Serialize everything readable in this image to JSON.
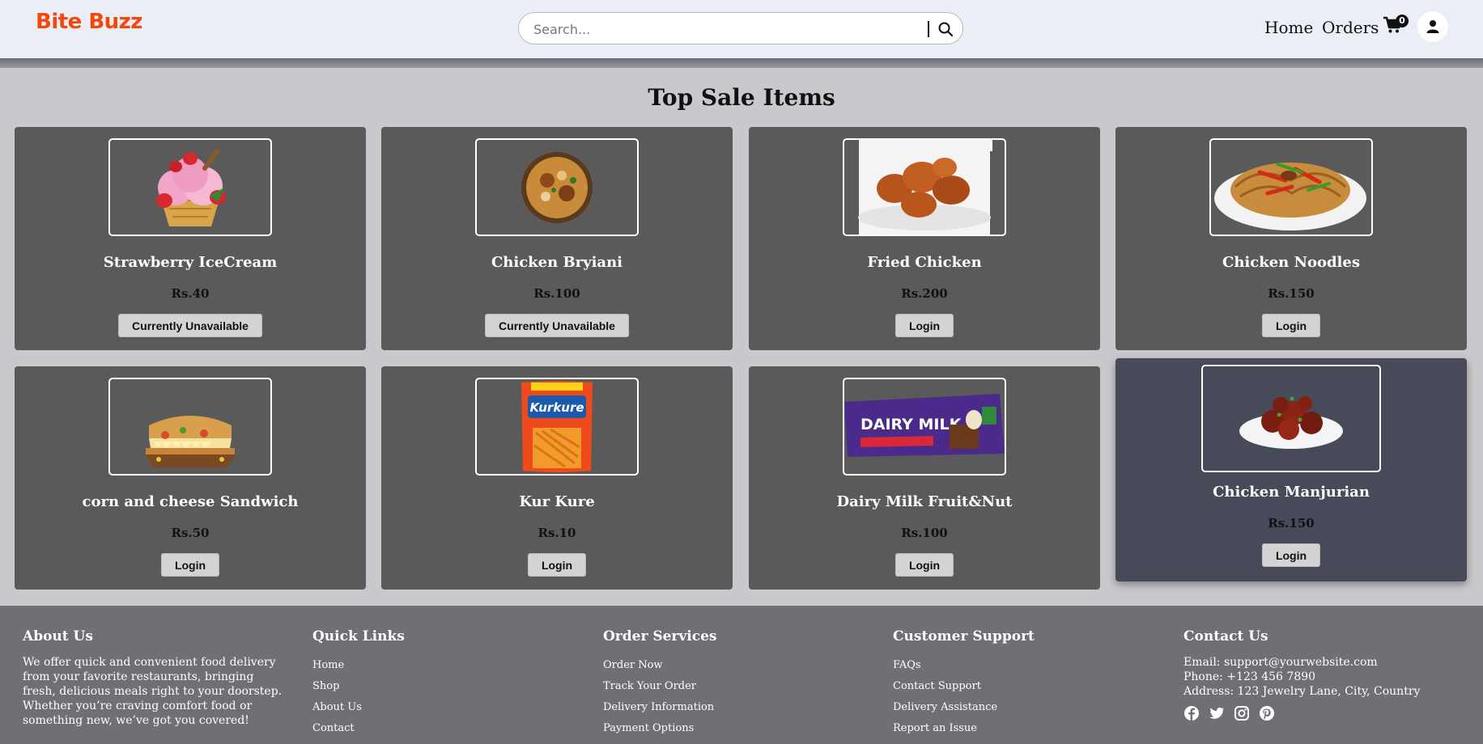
{
  "header": {
    "logo": "Bite Buzz",
    "search_placeholder": "Search...",
    "nav": {
      "home": "Home",
      "orders": "Orders"
    },
    "cart_count": "0"
  },
  "section_title": "Top Sale Items",
  "items": [
    {
      "name": "Strawberry IceCream",
      "price": "Rs.40",
      "button": "Currently Unavailable",
      "icon": "ice-cream-image"
    },
    {
      "name": "Chicken Bryiani",
      "price": "Rs.100",
      "button": "Currently Unavailable",
      "icon": "biryani-image"
    },
    {
      "name": "Fried Chicken",
      "price": "Rs.200",
      "button": "Login",
      "icon": "fried-chicken-image"
    },
    {
      "name": "Chicken Noodles",
      "price": "Rs.150",
      "button": "Login",
      "icon": "noodles-image"
    },
    {
      "name": "corn and cheese Sandwich",
      "price": "Rs.50",
      "button": "Login",
      "icon": "sandwich-image"
    },
    {
      "name": "Kur Kure",
      "price": "Rs.10",
      "button": "Login",
      "icon": "kurkure-image",
      "pack_text": "Kurkure"
    },
    {
      "name": "Dairy Milk Fruit&Nut",
      "price": "Rs.100",
      "button": "Login",
      "icon": "chocolate-image",
      "pack_text": "DAIRY MILK"
    },
    {
      "name": "Chicken Manjurian",
      "price": "Rs.150",
      "button": "Login",
      "icon": "manchurian-image"
    }
  ],
  "footer": {
    "about": {
      "title": "About Us",
      "text": "We offer quick and convenient food delivery from your favorite restaurants, bringing fresh, delicious meals right to your doorstep. Whether you’re craving comfort food or something new, we’ve got you covered!"
    },
    "quick_links": {
      "title": "Quick Links",
      "links": [
        "Home",
        "Shop",
        "About Us",
        "Contact"
      ]
    },
    "order_services": {
      "title": "Order Services",
      "links": [
        "Order Now",
        "Track Your Order",
        "Delivery Information",
        "Payment Options"
      ]
    },
    "support": {
      "title": "Customer Support",
      "links": [
        "FAQs",
        "Contact Support",
        "Delivery Assistance",
        "Report an Issue"
      ]
    },
    "contact": {
      "title": "Contact Us",
      "email": "Email: support@yourwebsite.com",
      "phone": "Phone: +123 456 7890",
      "address": "Address: 123 Jewelry Lane, City, Country"
    }
  },
  "colors": {
    "logo": "#f2480c",
    "card": "#5a5a5a",
    "card_highlight": "#474a58",
    "footer": "#6f6f74"
  }
}
